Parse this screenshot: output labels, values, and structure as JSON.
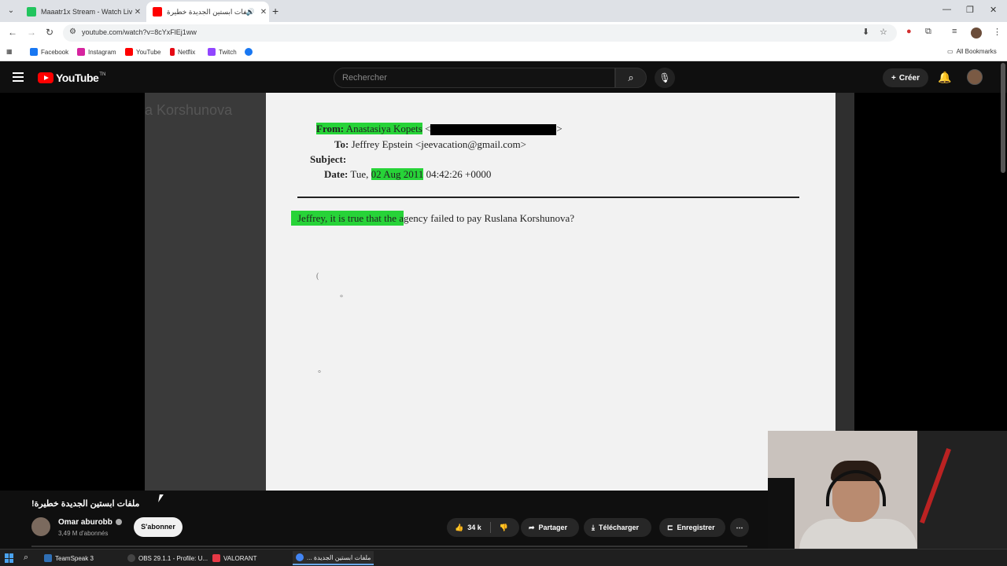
{
  "browser": {
    "tabs": [
      {
        "title": "Maaatr1x Stream - Watch Live o",
        "favicon_color": "#22c55e"
      },
      {
        "title": "ملفات ابستين الجديدة خطيرة",
        "favicon_color": "#ff0000"
      }
    ],
    "url": "youtube.com/watch?v=8cYxFlEj1ww",
    "bookmarks": [
      {
        "label": "Facebook",
        "color": "#1877f2"
      },
      {
        "label": "Instagram",
        "color": "#d6249f"
      },
      {
        "label": "YouTube",
        "color": "#ff0000"
      },
      {
        "label": "Netflix",
        "color": "#e50914"
      },
      {
        "label": "Twitch",
        "color": "#9146ff"
      }
    ],
    "all_bookmarks": "All Bookmarks"
  },
  "youtube": {
    "logo_text": "YouTube",
    "logo_suffix": "TN",
    "search_placeholder": "Rechercher",
    "create_label": "Créer"
  },
  "document": {
    "from_label": "From:",
    "from_name": "Anastasiya Kopets",
    "from_open": "<",
    "from_close": ">",
    "to_label": "To:",
    "to_value": "Jeffrey Epstein <jeevacation@gmail.com>",
    "subject_label": "Subject:",
    "date_label": "Date:",
    "date_day": "Tue,",
    "date_highlight": "02 Aug 2011",
    "date_rest": "04:42:26 +0000",
    "body_highlight": "Jeffrey, it is true that the a",
    "body_rest": "gency failed to pay Ruslana Korshunova?",
    "ghost_text": "a Korshunova"
  },
  "video": {
    "title": "ملفات ابستين الجديدة خطيرة!",
    "channel": "Omar aburobb",
    "subscribers": "3,49 M d'abonnés",
    "subscribe": "S'abonner",
    "likes": "34 k",
    "share": "Partager",
    "download": "Télécharger",
    "save": "Enregistrer"
  },
  "taskbar": [
    {
      "label": "TeamSpeak 3",
      "color": "#2f6fb5"
    },
    {
      "label": "OBS 29.1.1 - Profile: U...",
      "color": "#444444"
    },
    {
      "label": "VALORANT",
      "color": "#e63946"
    },
    {
      "label": "... ملفات ابستين الجديدة",
      "color": "#4285f4"
    }
  ]
}
